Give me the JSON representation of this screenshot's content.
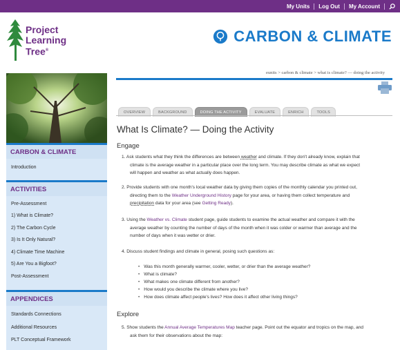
{
  "topnav": {
    "my_units": "My Units",
    "log_out": "Log Out",
    "my_account": "My Account"
  },
  "logo": {
    "line1": "Project",
    "line2": "Learning",
    "line3": "Tree",
    "reg": "®"
  },
  "site_title": "CARBON & CLIMATE",
  "breadcrumb": "eunits  >  carbon & climate  >  what is climate? — doing the activity",
  "tabs": [
    "OVERVIEW",
    "BACKGROUND",
    "DOING THE ACTIVITY",
    "EVALUATE",
    "ENRICH",
    "TOOLS"
  ],
  "sidebar": {
    "section1": {
      "title": "CARBON & CLIMATE",
      "items": [
        "Introduction"
      ]
    },
    "section2": {
      "title": "ACTIVITIES",
      "items": [
        "Pre-Assessment",
        "1) What is Climate?",
        "2) The Carbon Cycle",
        "3) Is It Only Natural?",
        "4) Climate Time Machine",
        "5) Are You a Bigfoot?",
        "Post-Assessment"
      ]
    },
    "section3": {
      "title": "APPENDICES",
      "items": [
        "Standards Connections",
        "Additional Resources",
        "PLT Conceptual Framework"
      ]
    }
  },
  "main": {
    "title": "What Is Climate? — Doing the Activity",
    "engage": "Engage",
    "explore": "Explore",
    "step1": {
      "a": "1. Ask students what they think the differences are between ",
      "link": "weather",
      "b": " and climate. If they don't already know, explain that",
      "c": "climate is the average weather in a particular place over the long term. You may describe climate as what we expect",
      "d": "will happen and weather as what actually does happen."
    },
    "step2": {
      "a": "2. Provide students with one month's local weather data by giving them copies of the monthly calendar you printed out,",
      "b": "directing them to the ",
      "link1": "Weather Underground History",
      "c": " page for your area, or having them collect temperature and",
      "link2": "precipitation",
      "d": " data for your area (see ",
      "link3": "Getting Ready",
      "e": ")."
    },
    "step3": {
      "a": "3. Using the ",
      "link": "Weather vs. Climate",
      "b": " student page, guide students to examine the actual weather and compare it with the",
      "c": "average weather by counting the number of days of the month when it was colder or warmer than average and the",
      "d": "number of days when it was wetter or drier."
    },
    "step4": {
      "a": "4. Discuss student findings and climate in general, posing such questions as:",
      "bullets": [
        "Was this month generally warmer, cooler, wetter, or drier than the average weather?",
        "What is climate?",
        "What makes one climate different from another?",
        "How would you describe the climate where you live?",
        "How does climate affect people's lives? How does it affect other living things?"
      ]
    },
    "step5": {
      "a": "5. Show students the ",
      "link": "Annual Average Temperatures Map",
      "b": " teacher page. Point out the equator and tropics on the map, and",
      "c": "ask them for their observations about the map:"
    }
  },
  "colors": {
    "brand_purple": "#6e2f86",
    "accent_blue": "#1a7ac9",
    "sidebar_bg": "#d9e8f7"
  }
}
